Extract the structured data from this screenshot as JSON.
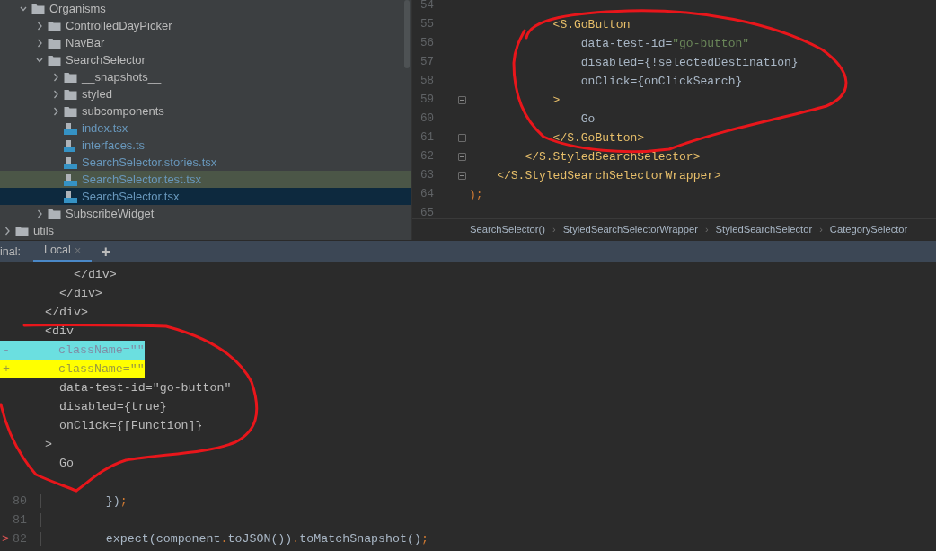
{
  "project_tree": {
    "items": [
      {
        "label": "Organisms",
        "kind": "folder",
        "expanded": true,
        "selected": false,
        "highlighted": false,
        "changed": false,
        "children": [
          {
            "label": "ControlledDayPicker",
            "kind": "folder",
            "expanded": false,
            "selected": false,
            "highlighted": false,
            "changed": false
          },
          {
            "label": "NavBar",
            "kind": "folder",
            "expanded": false,
            "selected": false,
            "highlighted": false,
            "changed": false
          },
          {
            "label": "SearchSelector",
            "kind": "folder",
            "expanded": true,
            "selected": false,
            "highlighted": false,
            "changed": false,
            "children": [
              {
                "label": "__snapshots__",
                "kind": "folder",
                "expanded": false,
                "selected": false,
                "highlighted": false,
                "changed": false
              },
              {
                "label": "styled",
                "kind": "folder",
                "expanded": false,
                "selected": false,
                "highlighted": false,
                "changed": false
              },
              {
                "label": "subcomponents",
                "kind": "folder",
                "expanded": false,
                "selected": false,
                "highlighted": false,
                "changed": false
              },
              {
                "label": "index.tsx",
                "kind": "tsx",
                "selected": false,
                "highlighted": false,
                "changed": true
              },
              {
                "label": "interfaces.ts",
                "kind": "ts",
                "selected": false,
                "highlighted": false,
                "changed": true
              },
              {
                "label": "SearchSelector.stories.tsx",
                "kind": "tsx",
                "selected": false,
                "highlighted": false,
                "changed": true
              },
              {
                "label": "SearchSelector.test.tsx",
                "kind": "tsx",
                "selected": false,
                "highlighted": true,
                "changed": true
              },
              {
                "label": "SearchSelector.tsx",
                "kind": "tsx",
                "selected": true,
                "highlighted": false,
                "changed": true
              }
            ]
          },
          {
            "label": "SubscribeWidget",
            "kind": "folder",
            "expanded": false,
            "selected": false,
            "highlighted": false,
            "changed": false
          }
        ]
      }
    ],
    "outer_items": [
      {
        "label": "utils",
        "kind": "folder",
        "expanded": false,
        "selected": false,
        "highlighted": false,
        "changed": false
      }
    ]
  },
  "editor": {
    "lines": [
      {
        "number": "54",
        "fold": false
      },
      {
        "number": "55",
        "fold": false,
        "tokens": [
          {
            "text": "            <S.GoButton",
            "kind": "tag"
          }
        ]
      },
      {
        "number": "56",
        "fold": false,
        "tokens": [
          {
            "text": "                data-test-id=",
            "kind": "plain"
          },
          {
            "text": "\"go-button\"",
            "kind": "string"
          }
        ]
      },
      {
        "number": "57",
        "fold": false,
        "tokens": [
          {
            "text": "                disabled={!selectedDestination}",
            "kind": "plain"
          }
        ]
      },
      {
        "number": "58",
        "fold": false,
        "tokens": [
          {
            "text": "                onClick={onClickSearch}",
            "kind": "plain"
          }
        ]
      },
      {
        "number": "59",
        "fold": true,
        "tokens": [
          {
            "text": "            >",
            "kind": "tag"
          }
        ]
      },
      {
        "number": "60",
        "fold": false,
        "tokens": [
          {
            "text": "                Go",
            "kind": "plain"
          }
        ]
      },
      {
        "number": "61",
        "fold": true,
        "tokens": [
          {
            "text": "            </S.GoButton>",
            "kind": "tag"
          }
        ]
      },
      {
        "number": "62",
        "fold": true,
        "tokens": [
          {
            "text": "        </S.StyledSearchSelector>",
            "kind": "tag"
          }
        ]
      },
      {
        "number": "63",
        "fold": true,
        "tokens": [
          {
            "text": "    </S.StyledSearchSelectorWrapper>",
            "kind": "tag"
          }
        ]
      },
      {
        "number": "64",
        "fold": false,
        "tokens": [
          {
            "text": ");",
            "kind": "punct"
          }
        ]
      },
      {
        "number": "65",
        "fold": false
      }
    ],
    "breadcrumbs": [
      {
        "label": "SearchSelector()"
      },
      {
        "separator": "›",
        "label": "StyledSearchSelectorWrapper"
      },
      {
        "separator": "›",
        "label": "StyledSearchSelector"
      },
      {
        "separator": "›",
        "label": "CategorySelector"
      }
    ]
  },
  "terminal": {
    "label": "inal:",
    "tabs": [
      {
        "label": "Local",
        "selected": true,
        "close": "×"
      }
    ],
    "add_tab": "+",
    "lines": [
      {
        "kind": "plain",
        "text": "    </div>"
      },
      {
        "kind": "plain",
        "text": "  </div>"
      },
      {
        "kind": "plain",
        "text": "</div>"
      },
      {
        "kind": "plain",
        "text": "<div"
      },
      {
        "kind": "removed",
        "sign": "-",
        "text": "className=\"\""
      },
      {
        "kind": "added",
        "sign": "+",
        "text": "className=\"\""
      },
      {
        "kind": "plain",
        "text": "  data-test-id=\"go-button\""
      },
      {
        "kind": "plain",
        "text": "  disabled={true}"
      },
      {
        "kind": "plain",
        "text": "  onClick={[Function]}"
      },
      {
        "kind": "plain",
        "text": ">"
      },
      {
        "kind": "plain",
        "text": "  Go"
      },
      {
        "kind": "blank"
      },
      {
        "kind": "source",
        "number": "80",
        "tokens": [
          {
            "text": "        })",
            "kind": "plain"
          },
          {
            "text": ";",
            "kind": "punct"
          }
        ]
      },
      {
        "kind": "source",
        "number": "81"
      },
      {
        "kind": "source",
        "number": "82",
        "marker": ">",
        "tokens": [
          {
            "text": "        expect(component",
            "kind": "plain"
          },
          {
            "text": ".",
            "kind": "punct"
          },
          {
            "text": "toJSON())",
            "kind": "plain"
          },
          {
            "text": ".",
            "kind": "punct"
          },
          {
            "text": "toMatchSnapshot()",
            "kind": "plain"
          },
          {
            "text": ";",
            "kind": "punct"
          }
        ]
      }
    ]
  }
}
